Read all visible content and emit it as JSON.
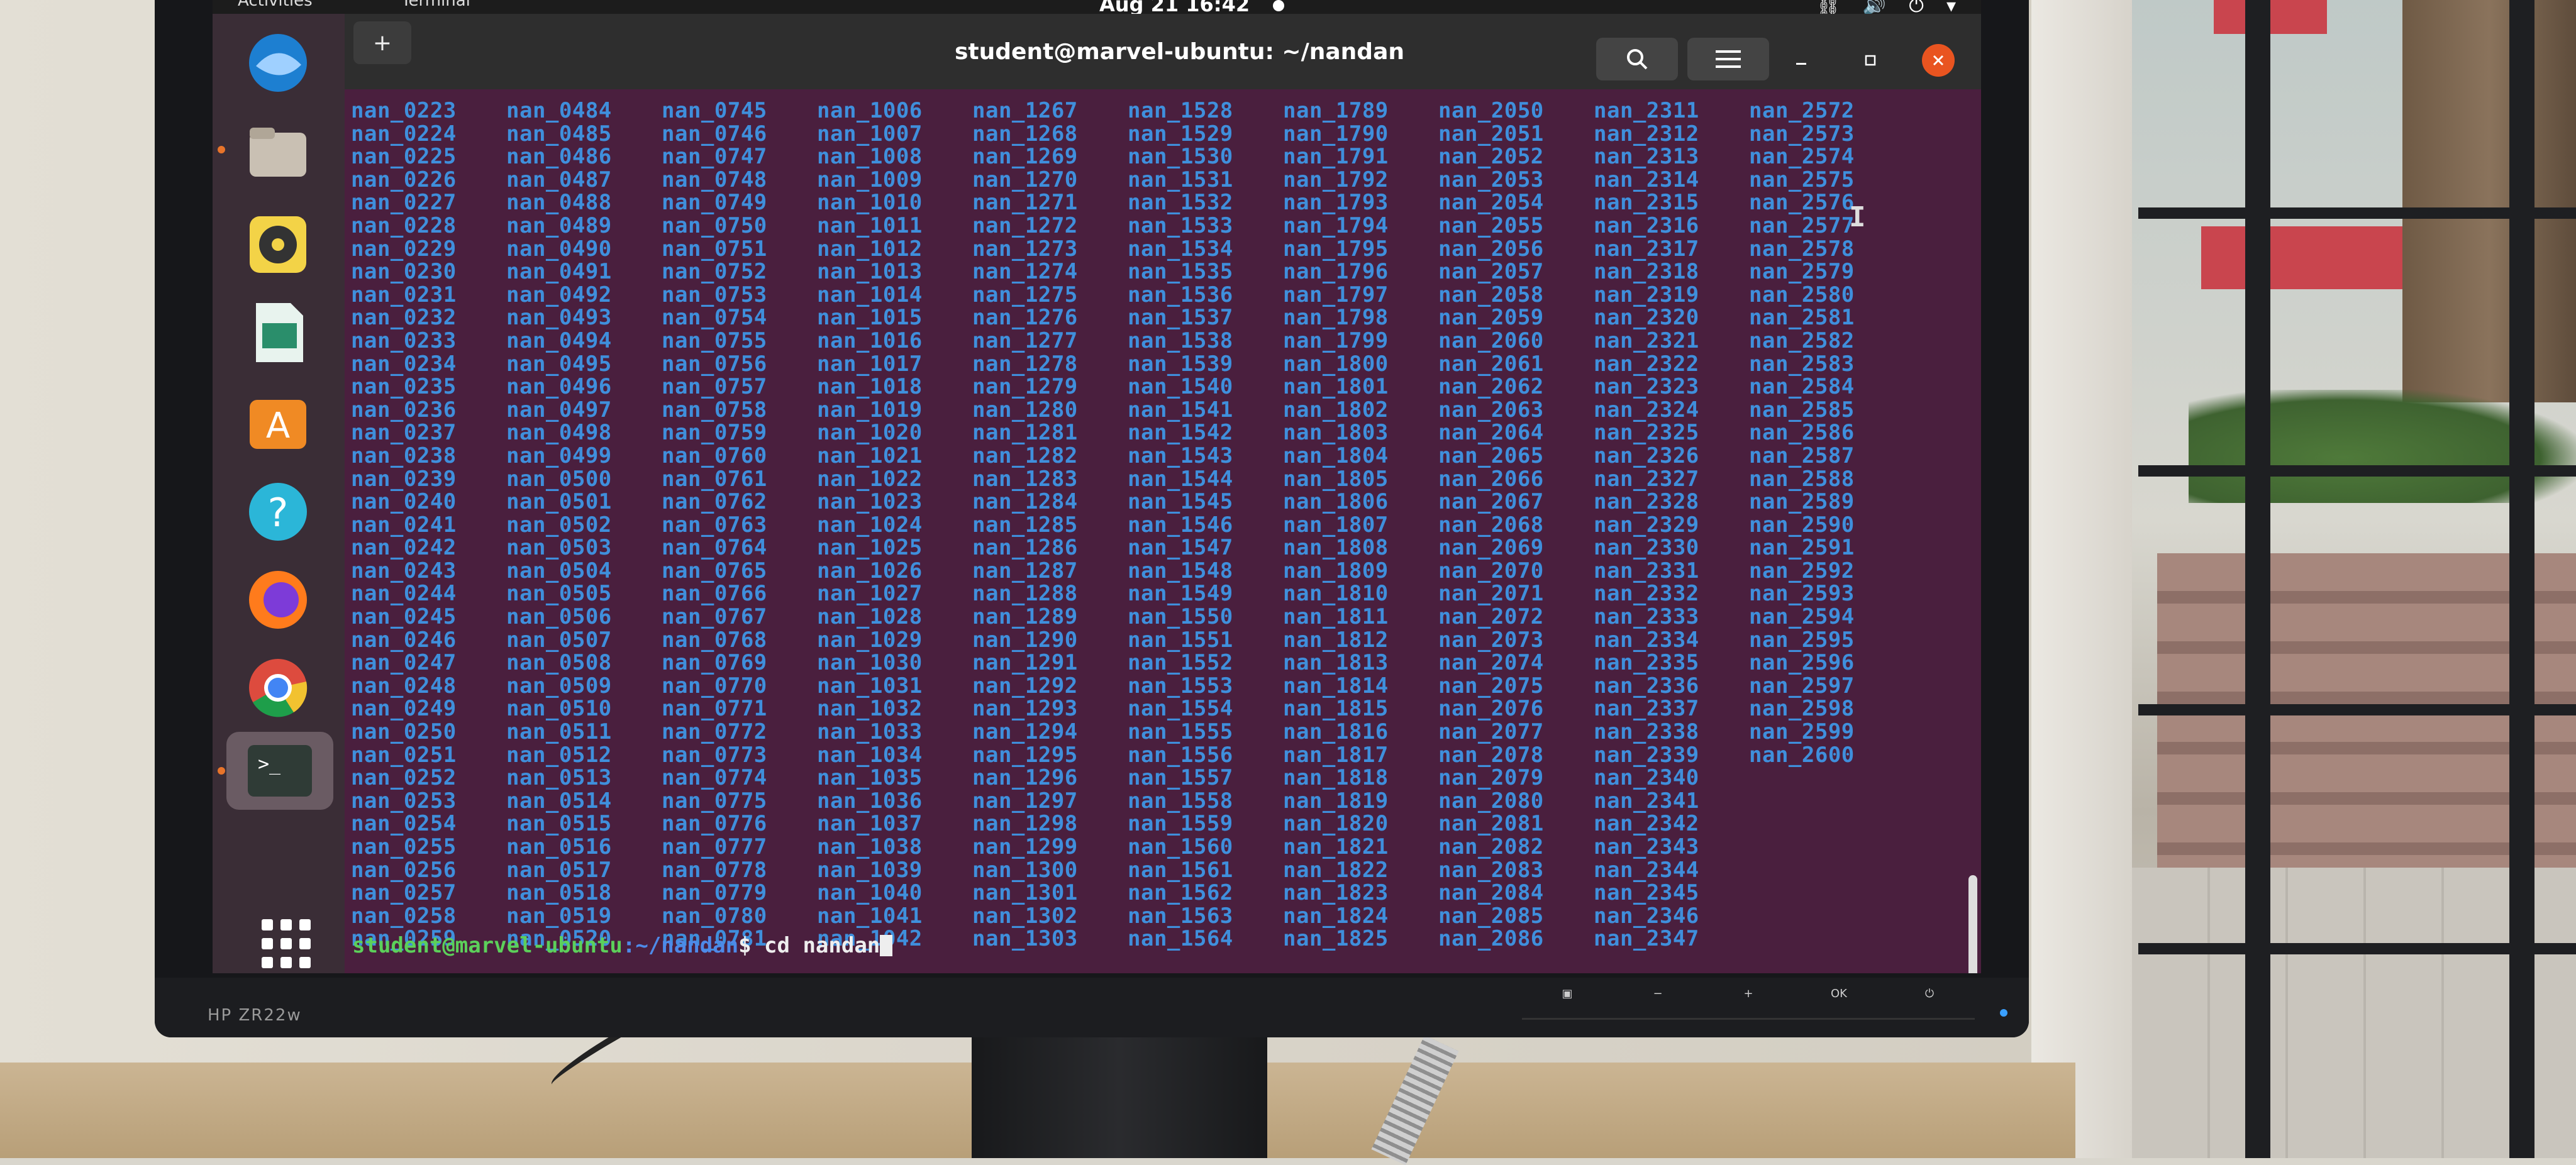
{
  "topbar": {
    "activities": "Activities",
    "app_name": "Terminal",
    "clock": "Aug 21  16:42"
  },
  "window": {
    "title": "student@marvel-ubuntu: ~/nandan",
    "new_tab": "+"
  },
  "terminal": {
    "columns": [
      [
        "nan_0223",
        "nan_0224",
        "nan_0225",
        "nan_0226",
        "nan_0227",
        "nan_0228",
        "nan_0229",
        "nan_0230",
        "nan_0231",
        "nan_0232",
        "nan_0233",
        "nan_0234",
        "nan_0235",
        "nan_0236",
        "nan_0237",
        "nan_0238",
        "nan_0239",
        "nan_0240",
        "nan_0241",
        "nan_0242",
        "nan_0243",
        "nan_0244",
        "nan_0245",
        "nan_0246",
        "nan_0247",
        "nan_0248",
        "nan_0249",
        "nan_0250",
        "nan_0251",
        "nan_0252",
        "nan_0253",
        "nan_0254",
        "nan_0255",
        "nan_0256",
        "nan_0257",
        "nan_0258",
        "nan_0259"
      ],
      [
        "nan_0484",
        "nan_0485",
        "nan_0486",
        "nan_0487",
        "nan_0488",
        "nan_0489",
        "nan_0490",
        "nan_0491",
        "nan_0492",
        "nan_0493",
        "nan_0494",
        "nan_0495",
        "nan_0496",
        "nan_0497",
        "nan_0498",
        "nan_0499",
        "nan_0500",
        "nan_0501",
        "nan_0502",
        "nan_0503",
        "nan_0504",
        "nan_0505",
        "nan_0506",
        "nan_0507",
        "nan_0508",
        "nan_0509",
        "nan_0510",
        "nan_0511",
        "nan_0512",
        "nan_0513",
        "nan_0514",
        "nan_0515",
        "nan_0516",
        "nan_0517",
        "nan_0518",
        "nan_0519",
        "nan_0520"
      ],
      [
        "nan_0745",
        "nan_0746",
        "nan_0747",
        "nan_0748",
        "nan_0749",
        "nan_0750",
        "nan_0751",
        "nan_0752",
        "nan_0753",
        "nan_0754",
        "nan_0755",
        "nan_0756",
        "nan_0757",
        "nan_0758",
        "nan_0759",
        "nan_0760",
        "nan_0761",
        "nan_0762",
        "nan_0763",
        "nan_0764",
        "nan_0765",
        "nan_0766",
        "nan_0767",
        "nan_0768",
        "nan_0769",
        "nan_0770",
        "nan_0771",
        "nan_0772",
        "nan_0773",
        "nan_0774",
        "nan_0775",
        "nan_0776",
        "nan_0777",
        "nan_0778",
        "nan_0779",
        "nan_0780",
        "nan_0781"
      ],
      [
        "nan_1006",
        "nan_1007",
        "nan_1008",
        "nan_1009",
        "nan_1010",
        "nan_1011",
        "nan_1012",
        "nan_1013",
        "nan_1014",
        "nan_1015",
        "nan_1016",
        "nan_1017",
        "nan_1018",
        "nan_1019",
        "nan_1020",
        "nan_1021",
        "nan_1022",
        "nan_1023",
        "nan_1024",
        "nan_1025",
        "nan_1026",
        "nan_1027",
        "nan_1028",
        "nan_1029",
        "nan_1030",
        "nan_1031",
        "nan_1032",
        "nan_1033",
        "nan_1034",
        "nan_1035",
        "nan_1036",
        "nan_1037",
        "nan_1038",
        "nan_1039",
        "nan_1040",
        "nan_1041",
        "nan_1042"
      ],
      [
        "nan_1267",
        "nan_1268",
        "nan_1269",
        "nan_1270",
        "nan_1271",
        "nan_1272",
        "nan_1273",
        "nan_1274",
        "nan_1275",
        "nan_1276",
        "nan_1277",
        "nan_1278",
        "nan_1279",
        "nan_1280",
        "nan_1281",
        "nan_1282",
        "nan_1283",
        "nan_1284",
        "nan_1285",
        "nan_1286",
        "nan_1287",
        "nan_1288",
        "nan_1289",
        "nan_1290",
        "nan_1291",
        "nan_1292",
        "nan_1293",
        "nan_1294",
        "nan_1295",
        "nan_1296",
        "nan_1297",
        "nan_1298",
        "nan_1299",
        "nan_1300",
        "nan_1301",
        "nan_1302",
        "nan_1303"
      ],
      [
        "nan_1528",
        "nan_1529",
        "nan_1530",
        "nan_1531",
        "nan_1532",
        "nan_1533",
        "nan_1534",
        "nan_1535",
        "nan_1536",
        "nan_1537",
        "nan_1538",
        "nan_1539",
        "nan_1540",
        "nan_1541",
        "nan_1542",
        "nan_1543",
        "nan_1544",
        "nan_1545",
        "nan_1546",
        "nan_1547",
        "nan_1548",
        "nan_1549",
        "nan_1550",
        "nan_1551",
        "nan_1552",
        "nan_1553",
        "nan_1554",
        "nan_1555",
        "nan_1556",
        "nan_1557",
        "nan_1558",
        "nan_1559",
        "nan_1560",
        "nan_1561",
        "nan_1562",
        "nan_1563",
        "nan_1564"
      ],
      [
        "nan_1789",
        "nan_1790",
        "nan_1791",
        "nan_1792",
        "nan_1793",
        "nan_1794",
        "nan_1795",
        "nan_1796",
        "nan_1797",
        "nan_1798",
        "nan_1799",
        "nan_1800",
        "nan_1801",
        "nan_1802",
        "nan_1803",
        "nan_1804",
        "nan_1805",
        "nan_1806",
        "nan_1807",
        "nan_1808",
        "nan_1809",
        "nan_1810",
        "nan_1811",
        "nan_1812",
        "nan_1813",
        "nan_1814",
        "nan_1815",
        "nan_1816",
        "nan_1817",
        "nan_1818",
        "nan_1819",
        "nan_1820",
        "nan_1821",
        "nan_1822",
        "nan_1823",
        "nan_1824",
        "nan_1825"
      ],
      [
        "nan_2050",
        "nan_2051",
        "nan_2052",
        "nan_2053",
        "nan_2054",
        "nan_2055",
        "nan_2056",
        "nan_2057",
        "nan_2058",
        "nan_2059",
        "nan_2060",
        "nan_2061",
        "nan_2062",
        "nan_2063",
        "nan_2064",
        "nan_2065",
        "nan_2066",
        "nan_2067",
        "nan_2068",
        "nan_2069",
        "nan_2070",
        "nan_2071",
        "nan_2072",
        "nan_2073",
        "nan_2074",
        "nan_2075",
        "nan_2076",
        "nan_2077",
        "nan_2078",
        "nan_2079",
        "nan_2080",
        "nan_2081",
        "nan_2082",
        "nan_2083",
        "nan_2084",
        "nan_2085",
        "nan_2086"
      ],
      [
        "nan_2311",
        "nan_2312",
        "nan_2313",
        "nan_2314",
        "nan_2315",
        "nan_2316",
        "nan_2317",
        "nan_2318",
        "nan_2319",
        "nan_2320",
        "nan_2321",
        "nan_2322",
        "nan_2323",
        "nan_2324",
        "nan_2325",
        "nan_2326",
        "nan_2327",
        "nan_2328",
        "nan_2329",
        "nan_2330",
        "nan_2331",
        "nan_2332",
        "nan_2333",
        "nan_2334",
        "nan_2335",
        "nan_2336",
        "nan_2337",
        "nan_2338",
        "nan_2339",
        "nan_2340",
        "nan_2341",
        "nan_2342",
        "nan_2343",
        "nan_2344",
        "nan_2345",
        "nan_2346",
        "nan_2347"
      ],
      [
        "nan_2572",
        "nan_2573",
        "nan_2574",
        "nan_2575",
        "nan_2576",
        "nan_2577",
        "nan_2578",
        "nan_2579",
        "nan_2580",
        "nan_2581",
        "nan_2582",
        "nan_2583",
        "nan_2584",
        "nan_2585",
        "nan_2586",
        "nan_2587",
        "nan_2588",
        "nan_2589",
        "nan_2590",
        "nan_2591",
        "nan_2592",
        "nan_2593",
        "nan_2594",
        "nan_2595",
        "nan_2596",
        "nan_2597",
        "nan_2598",
        "nan_2599",
        "nan_2600"
      ]
    ],
    "prompt_user": "student@marvel-ubuntu",
    "prompt_path": ":~/nandan",
    "prompt_command": "$ cd nandan"
  },
  "monitor": {
    "brand": "HP ZR22w",
    "controls": [
      "▣",
      "−",
      "+",
      "OK",
      "⏻"
    ]
  },
  "colors": {
    "terminal_bg": "#4a1f3e",
    "listing_text": "#3f8fdc",
    "prompt_user": "#5cd05a",
    "close_button": "#e95420"
  },
  "icons": {
    "dock": [
      "thunderbird-icon",
      "files-icon",
      "rhythmbox-icon",
      "libreoffice-impress-icon",
      "software-center-icon",
      "help-icon",
      "firefox-icon",
      "chrome-icon",
      "terminal-icon"
    ],
    "header": [
      "search-icon",
      "hamburger-menu-icon",
      "minimize-icon",
      "maximize-icon",
      "close-icon"
    ]
  }
}
